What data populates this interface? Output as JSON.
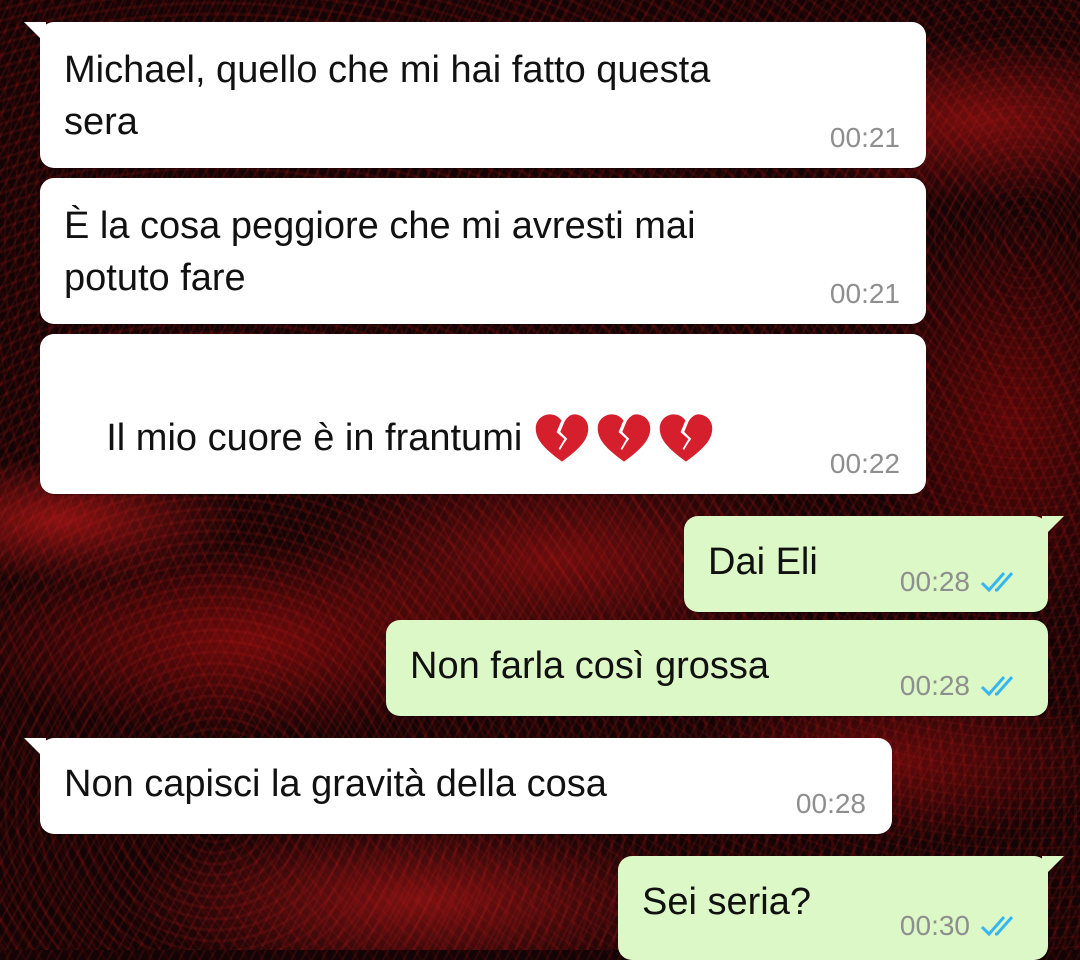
{
  "chat": {
    "messages": [
      {
        "direction": "incoming",
        "text": "Michael, quello che mi hai fatto questa\nsera",
        "time": "00:21"
      },
      {
        "direction": "incoming",
        "text": "È la cosa peggiore che mi avresti mai\npotuto fare",
        "time": "00:21"
      },
      {
        "direction": "incoming",
        "text": "Il mio cuore è in frantumi",
        "emoji": [
          "broken-heart",
          "broken-heart",
          "broken-heart"
        ],
        "time": "00:22"
      },
      {
        "direction": "outgoing",
        "text": "Dai Eli",
        "time": "00:28",
        "status": "read",
        "status_icon": "double-check-icon"
      },
      {
        "direction": "outgoing",
        "text": "Non farla così grossa",
        "time": "00:28",
        "status": "read",
        "status_icon": "double-check-icon"
      },
      {
        "direction": "incoming",
        "text": "Non capisci la gravità della cosa",
        "time": "00:28"
      },
      {
        "direction": "outgoing",
        "text": "Sei seria?",
        "time": "00:30",
        "status": "read",
        "status_icon": "double-check-icon"
      }
    ]
  },
  "colors": {
    "incoming_bubble": "#ffffff",
    "outgoing_bubble": "#dcf8c6",
    "read_ticks": "#34b7f1",
    "heart": "#d61f2c",
    "wallpaper": "#140405"
  }
}
